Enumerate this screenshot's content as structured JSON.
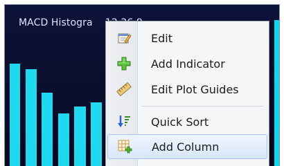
{
  "chart": {
    "title": "MACD Histogra",
    "title_suffix": "12,26,9",
    "bar_color": "#20d8f0",
    "background": "#0a1030"
  },
  "menu": {
    "items": [
      {
        "label": "Edit",
        "icon": "edit-icon"
      },
      {
        "label": "Add Indicator",
        "icon": "plus-icon"
      },
      {
        "label": "Edit Plot Guides",
        "icon": "ruler-icon"
      },
      {
        "label": "Quick Sort",
        "icon": "sort-icon"
      },
      {
        "label": "Add Column",
        "icon": "add-column-icon"
      }
    ],
    "hover_index": 4
  }
}
